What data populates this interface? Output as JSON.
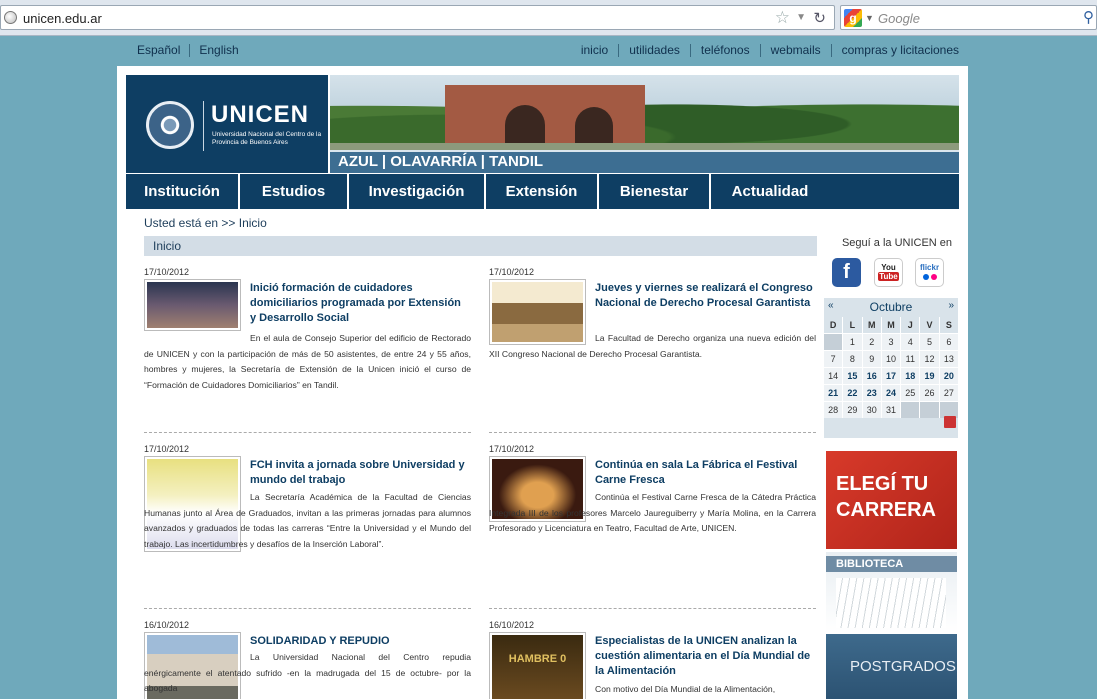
{
  "browser": {
    "url": "unicen.edu.ar",
    "search_placeholder": "Google"
  },
  "topnav": {
    "languages": [
      "Español",
      "English"
    ],
    "links": [
      "inicio",
      "utilidades",
      "teléfonos",
      "webmails",
      "compras y licitaciones"
    ]
  },
  "header": {
    "logo_name": "UNICEN",
    "logo_subtitle": "Universidad Nacional del Centro de la Provincia de Buenos Aires",
    "banner_caption": "AZUL | OLAVARRÍA | TANDIL"
  },
  "mainnav": [
    "Institución",
    "Estudios",
    "Investigación",
    "Extensión",
    "Bienestar",
    "Actualidad"
  ],
  "breadcrumb": "Usted está en >> Inicio",
  "section_title": "Inicio",
  "news": [
    {
      "date": "17/10/2012",
      "title": "Inició formación de cuidadores domiciliarios programada por Extensión y Desarrollo Social",
      "body": "En el aula de Consejo Superior del edificio de Rectorado de UNICEN y con la participación de más de 50 asistentes, de entre 24 y 55 años, hombres y mujeres, la Secretaría de Extensión de la Unicen inició el curso de “Formación de Cuidadores Domiciliarios” en Tandil."
    },
    {
      "date": "17/10/2012",
      "title": "Jueves y viernes se realizará el Congreso Nacional de Derecho Procesal Garantista",
      "body": "La Facultad de Derecho organiza una nueva edición del XII Congreso Nacional de Derecho Procesal Garantista."
    },
    {
      "date": "17/10/2012",
      "title": "FCH invita a jornada sobre Universidad y mundo del trabajo",
      "body": "La Secretaría Académica de la Facultad de Ciencias Humanas junto al Área de Graduados, invitan a las primeras jornadas para alumnos avanzados y graduados de todas las carreras “Entre la Universidad y el Mundo del trabajo. Las incertidumbres y desafíos de la Inserción Laboral”."
    },
    {
      "date": "17/10/2012",
      "title": "Continúa en sala La Fábrica el Festival Carne Fresca",
      "body": "Continúa el Festival Carne Fresca de la Cátedra Práctica Integrada III de los profesores Marcelo Jaureguiberry y María Molina, en la Carrera Profesorado y Licenciatura en Teatro, Facultad de Arte, UNICEN."
    },
    {
      "date": "16/10/2012",
      "title": "SOLIDARIDAD Y REPUDIO",
      "body": "La Universidad Nacional del Centro repudia enérgicamente el atentado sufrido -en la madrugada del 15 de octubre- por la abogada"
    },
    {
      "date": "16/10/2012",
      "title": "Especialistas de la UNICEN analizan la cuestión alimentaria en el Día Mundial de la Alimentación",
      "body": "Con motivo del Día Mundial de la Alimentación,"
    }
  ],
  "sidebar": {
    "follow_text": "Seguí a la UNICEN en",
    "social": [
      "facebook",
      "YouTube",
      "flickr"
    ],
    "calendar": {
      "prev": "«",
      "next": "»",
      "month": "Octubre",
      "day_headers": [
        "D",
        "L",
        "M",
        "M",
        "J",
        "V",
        "S"
      ],
      "weeks": [
        [
          "",
          "1",
          "2",
          "3",
          "4",
          "5",
          "6"
        ],
        [
          "7",
          "8",
          "9",
          "10",
          "11",
          "12",
          "13"
        ],
        [
          "14",
          "15",
          "16",
          "17",
          "18",
          "19",
          "20"
        ],
        [
          "21",
          "22",
          "23",
          "24",
          "25",
          "26",
          "27"
        ],
        [
          "28",
          "29",
          "30",
          "31",
          "",
          "",
          ""
        ]
      ]
    },
    "ad_elegi_line1": "ELEGÍ TU",
    "ad_elegi_line2": "CARRERA",
    "ad_biblioteca": "BIBLIOTECA",
    "ad_postgrados": "POSTGRADOS"
  },
  "colors": {
    "background": "#6fa9bb",
    "brand_navy": "#0e3e63",
    "banner_strip": "#3d6e92",
    "ad_red": "#d83a2a"
  }
}
